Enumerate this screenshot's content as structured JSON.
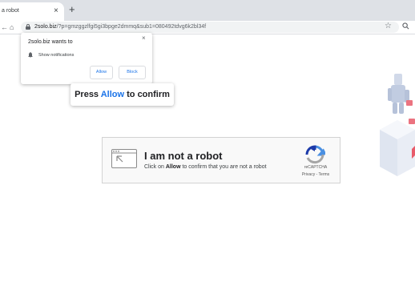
{
  "browser": {
    "tab_title": "a robot",
    "tab_close": "×",
    "new_tab": "+",
    "back_icon": "←",
    "home_icon": "⌂",
    "url_host": "2solo.biz",
    "url_path": "/?p=gmzggzlfgi5gi3bpge2dmmq&sub1=080492tdvg6k2bl34f",
    "star_icon": "☆",
    "zoom_icon": "🔍"
  },
  "notification": {
    "title": "2solo.biz wants to",
    "close": "×",
    "permission": "Show notifications",
    "allow": "Allow",
    "block": "Block"
  },
  "banner": {
    "prefix": "Press",
    "allow": "Allow",
    "suffix": "to confirm"
  },
  "captcha": {
    "title": "I am not a robot",
    "subtitle_prefix": "Click on",
    "subtitle_allow": "Allow",
    "subtitle_suffix": "to confirm that you are not a robot",
    "recaptcha_label": "reCAPTCHA",
    "links": "Privacy - Terms"
  },
  "colors": {
    "accent": "#1a73e8",
    "recaptcha_blue": "#4a90e2",
    "recaptcha_dark": "#1c3aa9"
  }
}
